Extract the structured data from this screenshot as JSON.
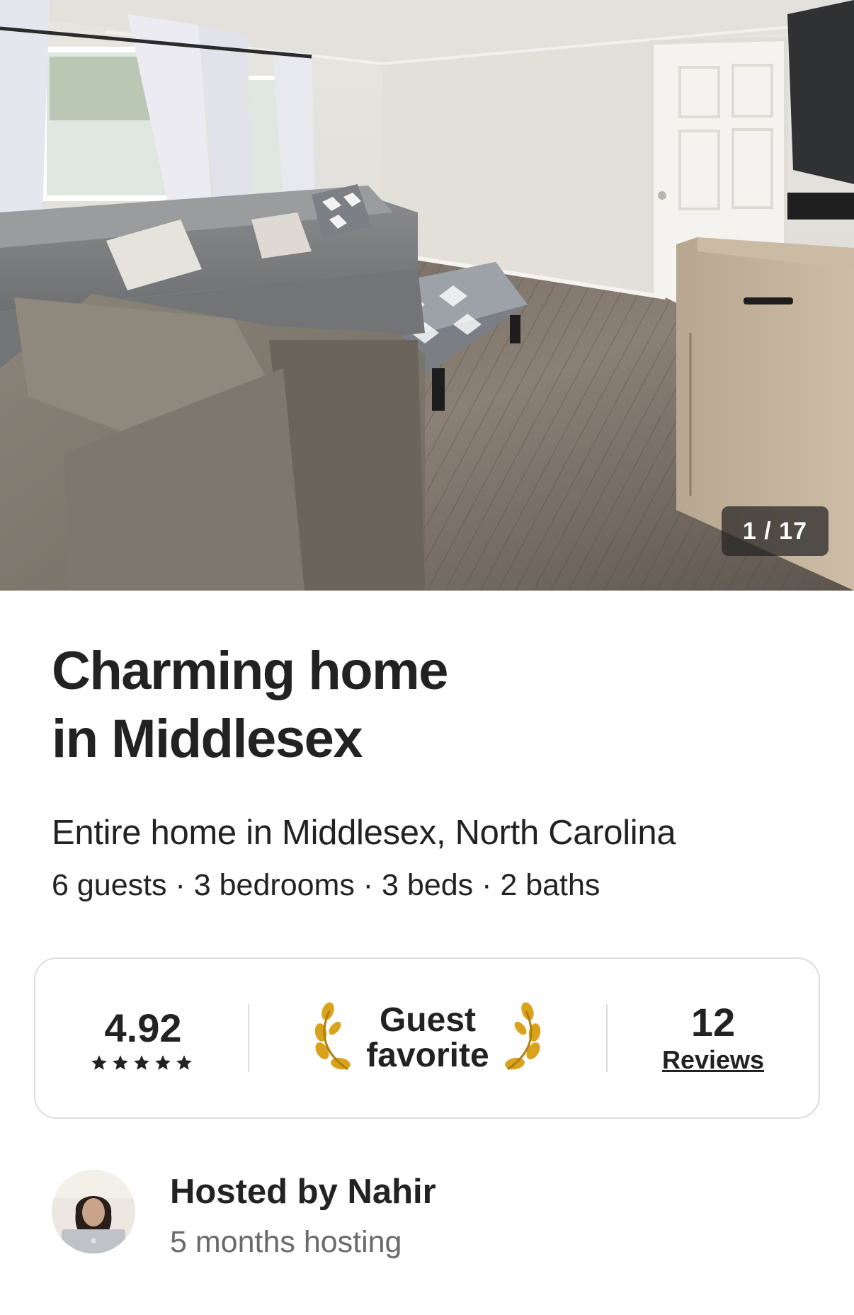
{
  "photo": {
    "counter": "1 / 17",
    "alt_icon": "living-room-photo"
  },
  "listing": {
    "title_line1": "Charming home",
    "title_line2": "in Middlesex",
    "subtitle": "Entire home in Middlesex, North Carolina",
    "details": "6 guests · 3 bedrooms · 3 beds · 2 baths"
  },
  "rating_card": {
    "rating": "4.92",
    "stars": 5,
    "guest_fav_line1": "Guest",
    "guest_fav_line2": "favorite",
    "reviews_count": "12",
    "reviews_label": "Reviews",
    "laurel_color": "#d9a21b"
  },
  "host": {
    "name": "Hosted by Nahir",
    "since": "5 months hosting"
  }
}
